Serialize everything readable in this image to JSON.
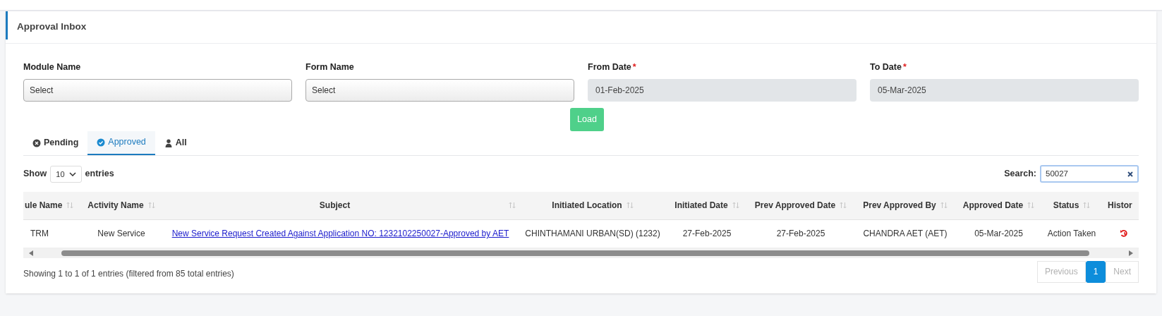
{
  "panel": {
    "title": "Approval Inbox"
  },
  "filters": [
    {
      "label": "Module Name",
      "kind": "select",
      "value": "Select"
    },
    {
      "label": "Form Name",
      "kind": "select",
      "value": "Select"
    },
    {
      "label": "From Date",
      "required_mark": "*",
      "kind": "date",
      "value": "01-Feb-2025"
    },
    {
      "label": "To Date",
      "required_mark": "*",
      "kind": "date",
      "value": "05-Mar-2025"
    }
  ],
  "load_button": "Load",
  "tabs": [
    {
      "label": "Pending",
      "selected": false
    },
    {
      "label": "Approved",
      "selected": true
    },
    {
      "label": "All",
      "selected": false
    }
  ],
  "length_menu": {
    "before": "Show",
    "value": "10",
    "after": "entries"
  },
  "search": {
    "label": "Search:",
    "value": "50027"
  },
  "table": {
    "columns": [
      {
        "label": "ule Name",
        "sortable": true
      },
      {
        "label": "Activity Name",
        "sortable": true
      },
      {
        "label": "Subject",
        "sortable": true
      },
      {
        "label": "Initiated Location",
        "sortable": true
      },
      {
        "label": "Initiated Date",
        "sortable": true
      },
      {
        "label": "Prev Approved Date",
        "sortable": true
      },
      {
        "label": "Prev Approved By",
        "sortable": true
      },
      {
        "label": "Approved Date",
        "sortable": true
      },
      {
        "label": "Status",
        "sortable": true
      },
      {
        "label": "Histor",
        "sortable": false
      }
    ],
    "rows": [
      {
        "cells": [
          {
            "kind": "text",
            "text": "TRM"
          },
          {
            "kind": "text",
            "text": "New Service"
          },
          {
            "kind": "link",
            "text": "New Service Request Created Against Application NO: 1232102250027-Approved by AET"
          },
          {
            "kind": "text",
            "text": "CHINTHAMANI URBAN(SD) (1232)"
          },
          {
            "kind": "text",
            "text": "27-Feb-2025"
          },
          {
            "kind": "text",
            "text": "27-Feb-2025"
          },
          {
            "kind": "text",
            "text": "CHANDRA AET (AET)"
          },
          {
            "kind": "text",
            "text": "05-Mar-2025"
          },
          {
            "kind": "text",
            "text": "Action Taken"
          },
          {
            "kind": "icon"
          }
        ]
      }
    ]
  },
  "info": "Showing 1 to 1 of 1 entries (filtered from 85 total entries)",
  "pagination": [
    {
      "label": "Previous",
      "selected": false,
      "disabled": true
    },
    {
      "label": "1",
      "selected": true,
      "disabled": false
    },
    {
      "label": "Next",
      "selected": false,
      "disabled": true
    }
  ]
}
